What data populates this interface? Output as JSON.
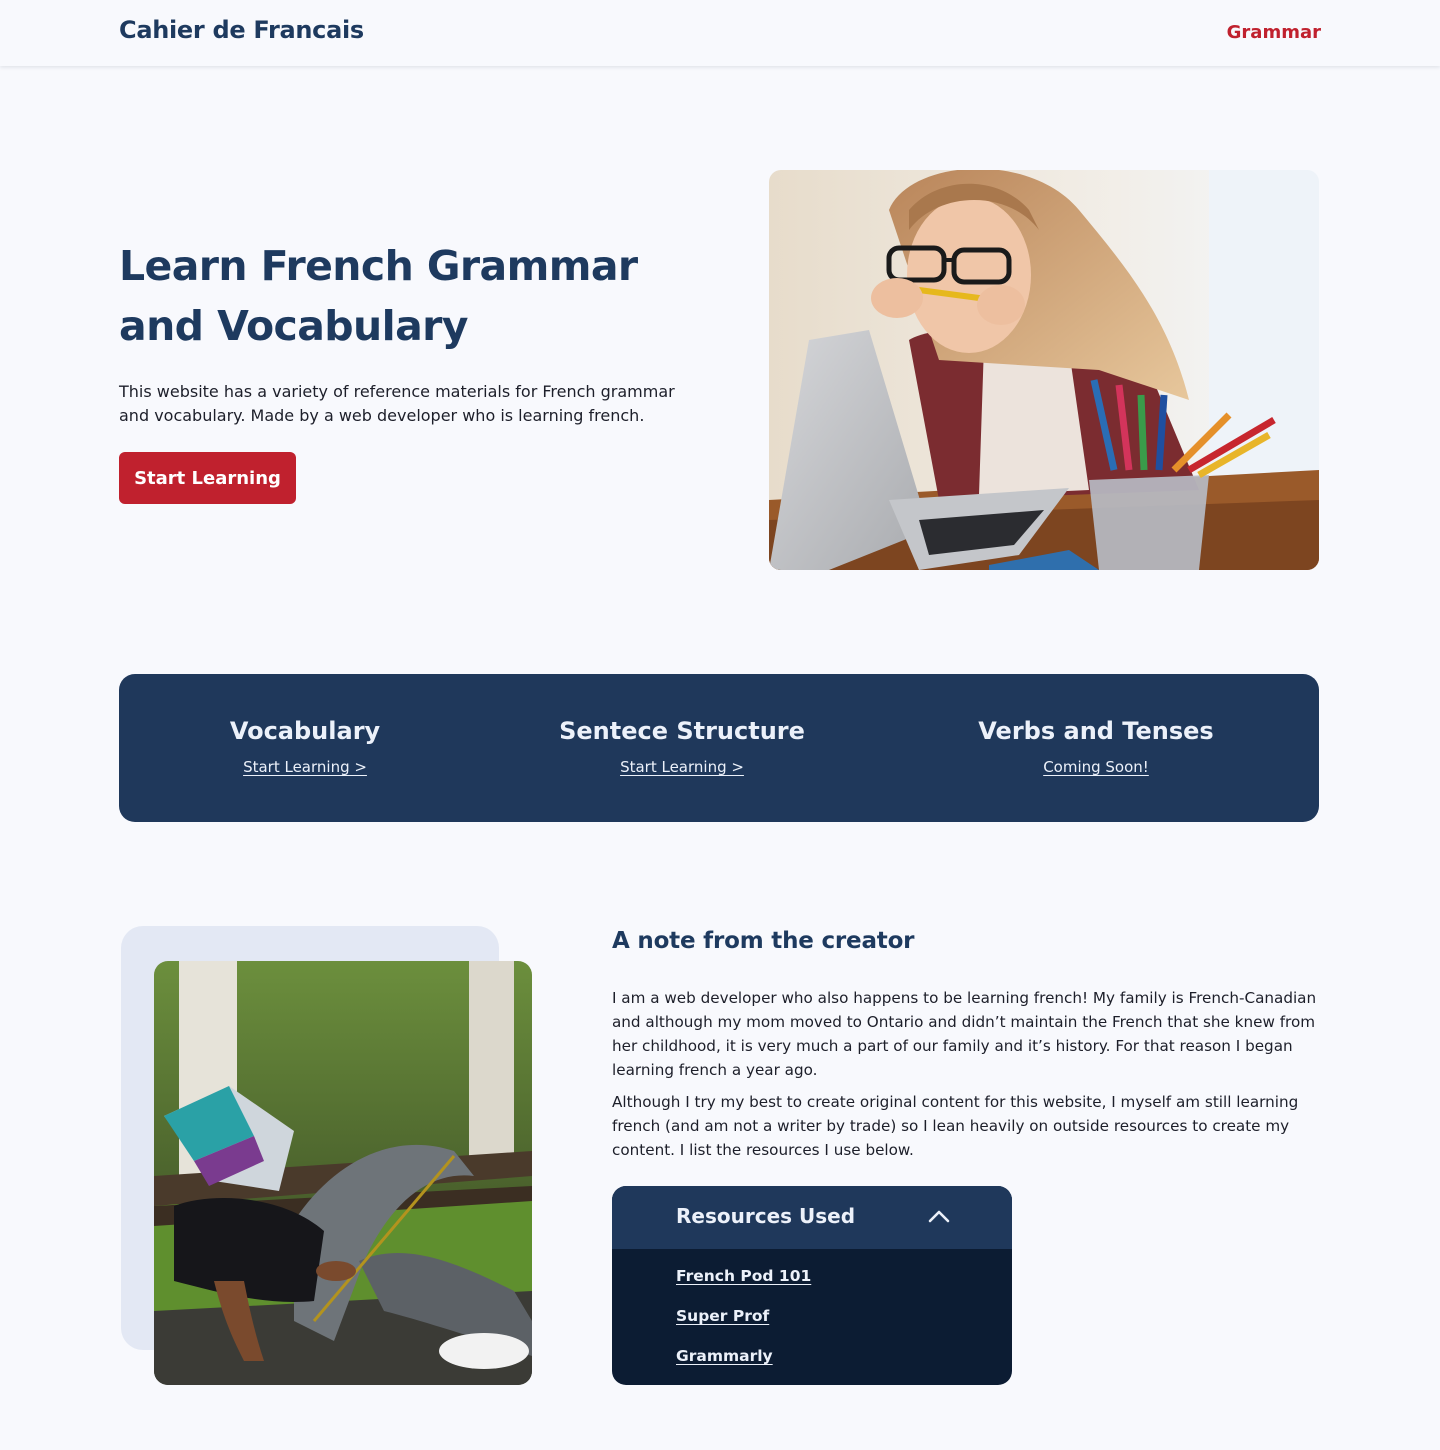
{
  "header": {
    "brand": "Cahier de Francais",
    "nav_link": "Grammar"
  },
  "hero": {
    "title": "Learn French Grammar and Vocabulary",
    "description": "This website has a variety of reference materials for French grammar and vocabulary. Made by a web developer who is learning french.",
    "button_label": "Start Learning"
  },
  "topics": [
    {
      "title": "Vocabulary",
      "link": "Start Learning >"
    },
    {
      "title": "Sentece Structure",
      "link": "Start Learning >"
    },
    {
      "title": "Verbs and Tenses",
      "link": "Coming Soon!"
    }
  ],
  "creator_note": {
    "title": "A note from the creator",
    "paragraph_1": "I am a web developer who also happens to be learning french! My family is French-Canadian and although my mom moved to Ontario and didn’t maintain the French that she knew from her childhood, it is very much a part of our family and it’s history. For that reason I began learning french a year ago.",
    "paragraph_2": "Although I try my best to create original content for this website, I myself am still learning french (and am not a writer by trade) so I lean heavily on outside resources to create my content. I list the resources I use below."
  },
  "resources": {
    "title": "Resources Used",
    "items": [
      "French Pod 101",
      "Super Prof",
      "Grammarly"
    ]
  },
  "colors": {
    "brand_navy": "#1e3a5f",
    "accent_red": "#c0212e",
    "panel_dark": "#0c1c33",
    "background": "#f8f9fd"
  },
  "icons": {
    "accordion_toggle": "chevron-up-icon"
  }
}
